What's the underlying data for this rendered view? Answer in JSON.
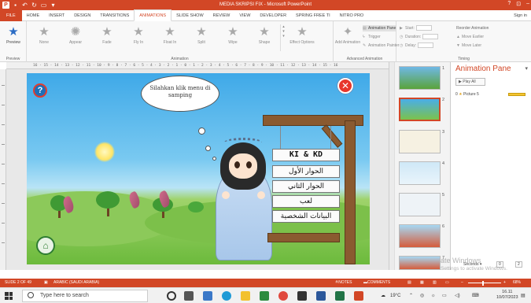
{
  "window": {
    "title": "MEDIA SKRIPSI FIX - Microsoft PowerPoint",
    "controls": [
      "?",
      "⊡",
      "–"
    ]
  },
  "tabs": {
    "items": [
      "FILE",
      "HOME",
      "INSERT",
      "DESIGN",
      "TRANSITIONS",
      "ANIMATIONS",
      "SLIDE SHOW",
      "REVIEW",
      "VIEW",
      "DEVELOPER",
      "SPRING FREE TI",
      "NITRO PRO"
    ],
    "active": "ANIMATIONS",
    "signin": "Sign in"
  },
  "ribbon": {
    "preview_label": "Preview",
    "preview_group": "Preview",
    "effects": [
      "None",
      "Appear",
      "Fade",
      "Fly In",
      "Float In",
      "Split",
      "Wipe",
      "Shape"
    ],
    "effect_options": "Effect Options",
    "animation_group": "Animation",
    "add_animation": "Add Animation",
    "animation_pane": "Animation Pane",
    "trigger": "Trigger",
    "animation_painter": "Animation Painter",
    "advanced_group": "Advanced Animation",
    "start": "Start:",
    "duration": "Duration:",
    "delay": "Delay:",
    "reorder_title": "Reorder Animation",
    "move_earlier": "Move Earlier",
    "move_later": "Move Later",
    "timing_group": "Timing"
  },
  "ruler": {
    "text": "16 · 15 · 14 · 13 · 12 · 11 · 10 · 9 · 8 · 7 · 6 · 5 · 4 · 3 · 2 · 1 · 0 · 1 · 2 · 3 · 4 · 5 · 6 · 7 · 8 · 9 · 10 · 11 · 12 · 13 · 14 · 15 · 16"
  },
  "slide": {
    "bubble_text": "Silahkan klik menu di samping",
    "menu_head": "KI & KD",
    "menu_items": [
      "الحوار الأول",
      "الحوار الثاني",
      "لعب",
      "البيانات الشخصية"
    ]
  },
  "thumbnails": {
    "numbers": [
      "1",
      "2",
      "3",
      "4",
      "5",
      "6",
      "7"
    ],
    "selected": "2"
  },
  "animation_pane": {
    "title": "Animation Pane",
    "play_all": "Play All",
    "item_number": "0",
    "item_name": "Picture 5",
    "seconds_label": "Seconds ▾",
    "zoom_nav": "0",
    "zoom_nav_2": "2"
  },
  "watermark": {
    "line1": "ate Windows",
    "line2": "Settings to activate Windows."
  },
  "statusbar": {
    "slide_of": "SLIDE 2 OF 49",
    "language": "ARABIC (SAUDI ARABIA)",
    "notes": "NOTES",
    "comments": "COMMENTS",
    "zoom": "68%"
  },
  "taskbar": {
    "search_placeholder": "Type here to search",
    "weather": "19°C",
    "time": "16.11",
    "date": "10/07/2023"
  },
  "colors": {
    "accent": "#d24726",
    "sky": "#3fa9e8",
    "grass": "#6cba3c"
  }
}
